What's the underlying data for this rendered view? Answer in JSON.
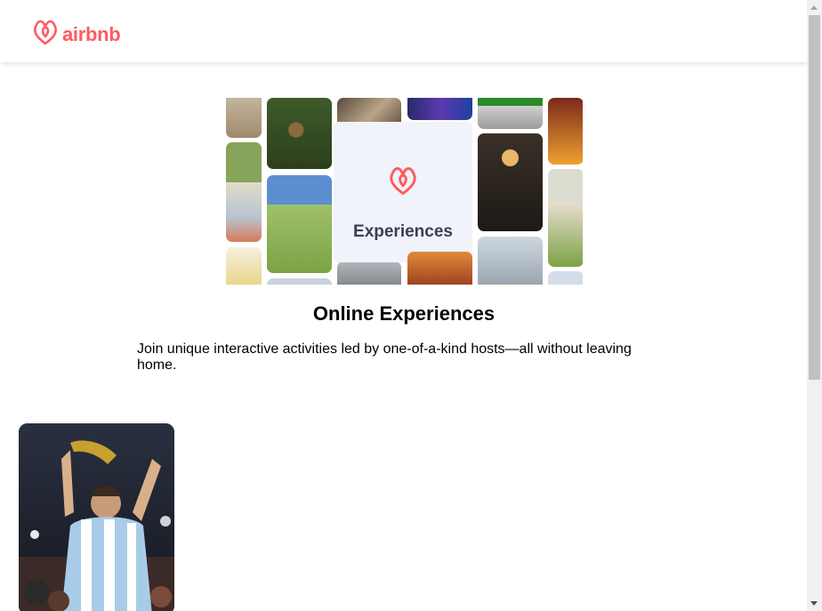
{
  "brand": {
    "logo_text": "airbnb",
    "color": "#ff5a5f"
  },
  "hero": {
    "card_label": "Experiences"
  },
  "section": {
    "title": "Online Experiences",
    "description": "Join unique interactive activities led by one-of-a-kind hosts—all without leaving home."
  },
  "colors": {
    "accent": "#ff5a5f",
    "card_bg": "#f1f3fa",
    "label_text": "#3a3f55"
  },
  "icons": [
    "airbnb-logo-icon"
  ]
}
